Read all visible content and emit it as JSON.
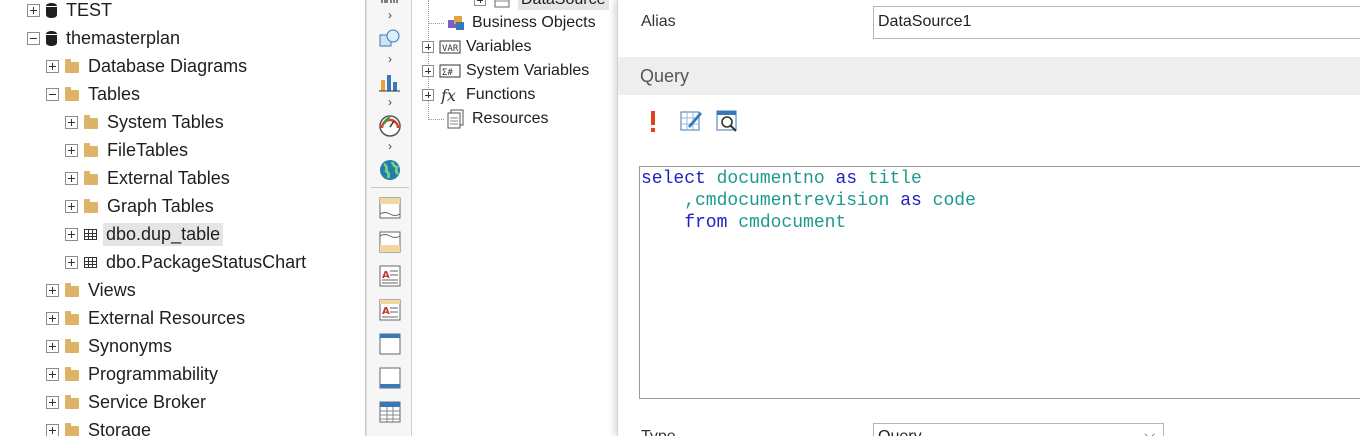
{
  "object_explorer": {
    "items": [
      {
        "label": "TEST",
        "level": 0,
        "icon": "database-icon",
        "expander": "plus"
      },
      {
        "label": "themasterplan",
        "level": 0,
        "icon": "database-icon",
        "expander": "minus"
      },
      {
        "label": "Database Diagrams",
        "level": 1,
        "icon": "folder-icon",
        "expander": "plus"
      },
      {
        "label": "Tables",
        "level": 1,
        "icon": "folder-icon",
        "expander": "minus"
      },
      {
        "label": "System Tables",
        "level": 2,
        "icon": "folder-icon",
        "expander": "plus"
      },
      {
        "label": "FileTables",
        "level": 2,
        "icon": "folder-icon",
        "expander": "plus"
      },
      {
        "label": "External Tables",
        "level": 2,
        "icon": "folder-icon",
        "expander": "plus"
      },
      {
        "label": "Graph Tables",
        "level": 2,
        "icon": "folder-icon",
        "expander": "plus"
      },
      {
        "label": "dbo.dup_table",
        "level": 2,
        "icon": "table-icon",
        "expander": "plus",
        "selected": true
      },
      {
        "label": "dbo.PackageStatusChart",
        "level": 2,
        "icon": "table-icon",
        "expander": "plus"
      },
      {
        "label": "Views",
        "level": 1,
        "icon": "folder-icon",
        "expander": "plus"
      },
      {
        "label": "External Resources",
        "level": 1,
        "icon": "folder-icon",
        "expander": "plus"
      },
      {
        "label": "Synonyms",
        "level": 1,
        "icon": "folder-icon",
        "expander": "plus"
      },
      {
        "label": "Programmability",
        "level": 1,
        "icon": "folder-icon",
        "expander": "plus"
      },
      {
        "label": "Service Broker",
        "level": 1,
        "icon": "folder-icon",
        "expander": "plus"
      },
      {
        "label": "Storage",
        "level": 1,
        "icon": "folder-icon",
        "expander": "plus"
      }
    ]
  },
  "toolbox": {
    "items": [
      "barcode-icon",
      "shapes-icon",
      "chart-icon",
      "gauge-icon",
      "globe-icon",
      "band-header-icon",
      "band-footer-icon",
      "text-component-icon",
      "rich-text-icon",
      "panel-icon",
      "container-icon",
      "table-component-icon"
    ]
  },
  "dictionary": {
    "partial_item": "DataSource",
    "items": [
      {
        "label": "Business Objects",
        "icon": "business-objects-icon",
        "expander": false
      },
      {
        "label": "Variables",
        "icon": "variables-icon",
        "expander": true
      },
      {
        "label": "System Variables",
        "icon": "system-variables-icon",
        "expander": true
      },
      {
        "label": "Functions",
        "icon": "functions-icon",
        "expander": true
      },
      {
        "label": "Resources",
        "icon": "resources-icon",
        "expander": false
      }
    ]
  },
  "properties": {
    "alias_label": "Alias",
    "alias_value": "DataSource1",
    "query_section_title": "Query",
    "query_lines": [
      [
        {
          "t": "select",
          "c": "kw"
        },
        {
          "t": " documentno ",
          "c": "id"
        },
        {
          "t": "as",
          "c": "kw"
        },
        {
          "t": " title",
          "c": "id"
        }
      ],
      [
        {
          "t": "    ,cmdocumentrevision ",
          "c": "id"
        },
        {
          "t": "as",
          "c": "kw"
        },
        {
          "t": " code",
          "c": "id"
        }
      ],
      [
        {
          "t": "    from ",
          "c": "kw"
        },
        {
          "t": "cmdocument",
          "c": "id"
        }
      ]
    ],
    "type_label": "Type",
    "type_value": "Query"
  },
  "colors": {
    "keyword": "#2020c0",
    "identifier": "#1e9a8c",
    "folder": "#dcb367",
    "run_accent": "#e0401c"
  }
}
